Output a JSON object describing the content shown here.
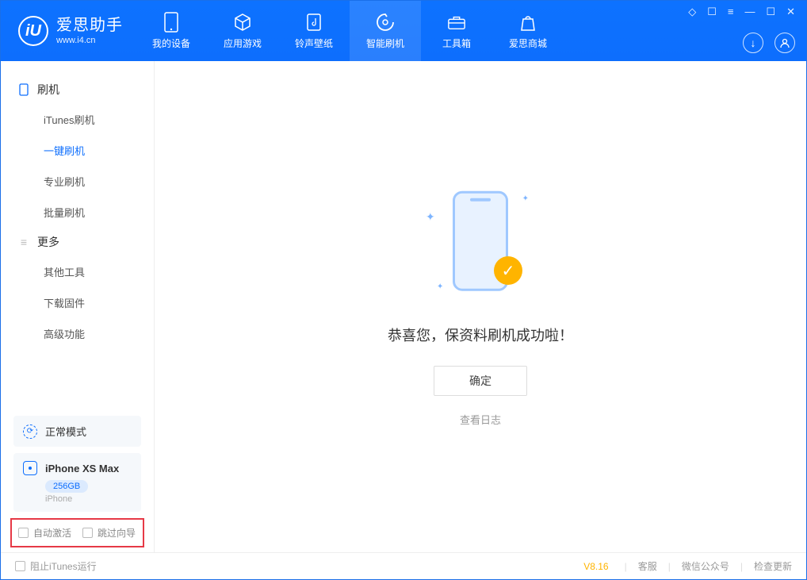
{
  "brand": {
    "title": "爱思助手",
    "subtitle": "www.i4.cn",
    "logo_letter": "iU"
  },
  "nav": {
    "items": [
      {
        "label": "我的设备",
        "icon": "device"
      },
      {
        "label": "应用游戏",
        "icon": "cube"
      },
      {
        "label": "铃声壁纸",
        "icon": "music"
      },
      {
        "label": "智能刷机",
        "icon": "refresh",
        "active": true
      },
      {
        "label": "工具箱",
        "icon": "toolbox"
      },
      {
        "label": "爱思商城",
        "icon": "store"
      }
    ]
  },
  "sidebar": {
    "section1": {
      "title": "刷机"
    },
    "items1": [
      {
        "label": "iTunes刷机"
      },
      {
        "label": "一键刷机",
        "active": true
      },
      {
        "label": "专业刷机"
      },
      {
        "label": "批量刷机"
      }
    ],
    "section2": {
      "title": "更多"
    },
    "items2": [
      {
        "label": "其他工具"
      },
      {
        "label": "下载固件"
      },
      {
        "label": "高级功能"
      }
    ],
    "status_mode": "正常模式",
    "device": {
      "name": "iPhone XS Max",
      "storage": "256GB",
      "type": "iPhone"
    },
    "checkboxes": {
      "auto_activate": "自动激活",
      "skip_guide": "跳过向导"
    }
  },
  "main": {
    "success_text": "恭喜您，保资料刷机成功啦！",
    "ok_button": "确定",
    "view_log": "查看日志"
  },
  "footer": {
    "block_itunes": "阻止iTunes运行",
    "version": "V8.16",
    "links": {
      "service": "客服",
      "wechat": "微信公众号",
      "update": "检查更新"
    }
  }
}
